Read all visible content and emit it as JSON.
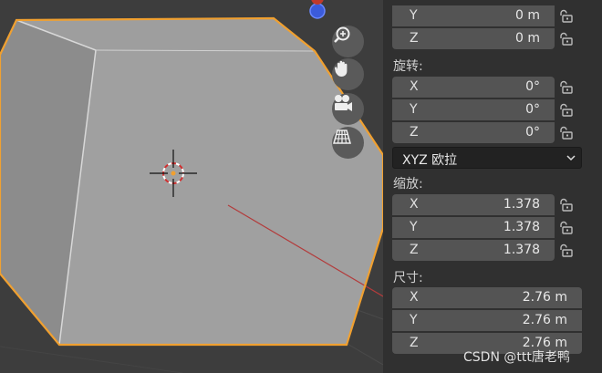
{
  "panel": {
    "location": {
      "y": {
        "axis": "Y",
        "value": "0 m"
      },
      "z": {
        "axis": "Z",
        "value": "0 m"
      }
    },
    "rotation": {
      "label": "旋转:",
      "x": {
        "axis": "X",
        "value": "0°"
      },
      "y": {
        "axis": "Y",
        "value": "0°"
      },
      "z": {
        "axis": "Z",
        "value": "0°"
      },
      "mode": "XYZ 欧拉"
    },
    "scale": {
      "label": "缩放:",
      "x": {
        "axis": "X",
        "value": "1.378"
      },
      "y": {
        "axis": "Y",
        "value": "1.378"
      },
      "z": {
        "axis": "Z",
        "value": "1.378"
      }
    },
    "dimensions": {
      "label": "尺寸:",
      "x": {
        "axis": "X",
        "value": "2.76 m"
      },
      "y": {
        "axis": "Y",
        "value": "2.76 m"
      },
      "z": {
        "axis": "Z",
        "value": "2.76 m"
      }
    }
  },
  "viewport": {
    "nav_icons": [
      "zoom-icon",
      "hand-pan-icon",
      "camera-icon",
      "grid-perspective-icon"
    ],
    "selection_color": "#f0a030"
  },
  "watermark": "CSDN @ttt唐老鸭"
}
